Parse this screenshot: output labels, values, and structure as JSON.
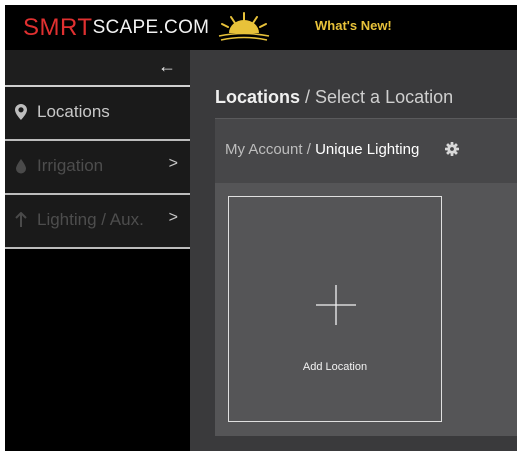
{
  "header": {
    "logo_primary": "SMRT",
    "logo_secondary": "SCAPE.COM",
    "whats_new": "What's New!",
    "brand_red": "#e03030",
    "accent_yellow": "#e8c23a"
  },
  "sidebar": {
    "back_icon": "arrow-left-icon",
    "items": [
      {
        "label": "Locations",
        "icon": "map-marker-icon",
        "active": true
      },
      {
        "label": "Irrigation",
        "icon": "water-drop-icon",
        "chevron": ">",
        "active": false
      },
      {
        "label": "Lighting / Aux.",
        "icon": "arrow-up-icon",
        "chevron": ">",
        "active": false
      }
    ]
  },
  "main": {
    "title": "Locations",
    "title_sep": " / ",
    "title_sub": "Select a Location",
    "breadcrumb": {
      "root": "My Account",
      "sep": " / ",
      "current": "Unique Lighting",
      "settings_icon": "gear-icon"
    },
    "cards": [
      {
        "label": "Add Location",
        "icon": "plus-icon"
      }
    ]
  }
}
